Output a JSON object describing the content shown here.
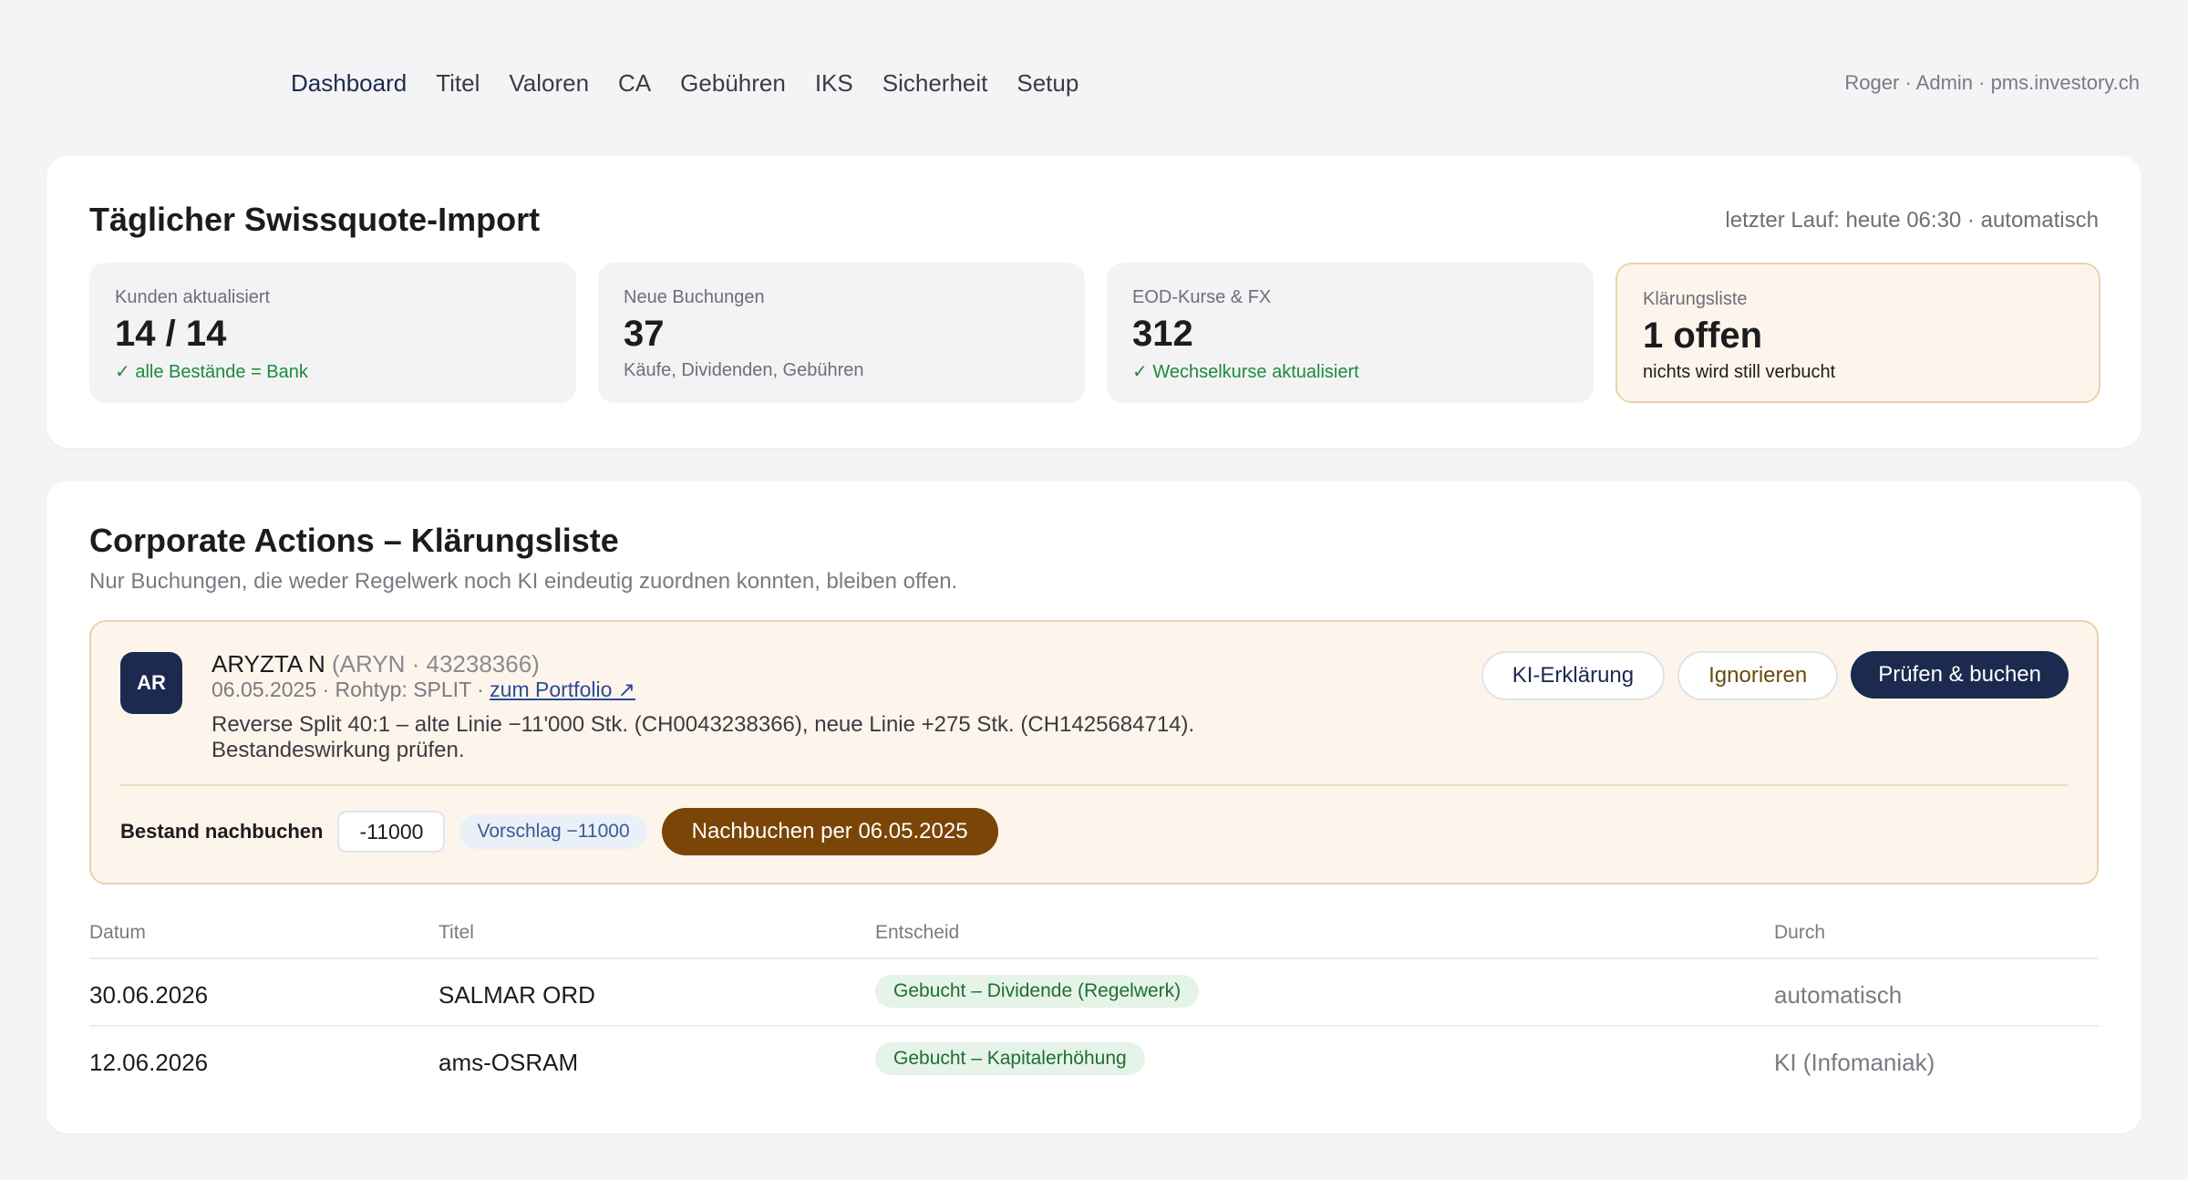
{
  "nav": {
    "items": [
      {
        "label": "Dashboard",
        "active": true
      },
      {
        "label": "Titel"
      },
      {
        "label": "Valoren"
      },
      {
        "label": "CA"
      },
      {
        "label": "Gebühren"
      },
      {
        "label": "IKS"
      },
      {
        "label": "Sicherheit"
      },
      {
        "label": "Setup"
      }
    ],
    "user_info": "Roger · Admin · pms.investory.ch"
  },
  "import": {
    "title": "Täglicher Swissquote-Import",
    "meta": "letzter Lauf: heute 06:30 · automatisch",
    "stats": [
      {
        "label": "Kunden aktualisiert",
        "value": "14 / 14",
        "sub": "✓ alle Bestände = Bank"
      },
      {
        "label": "Neue Buchungen",
        "value": "37",
        "sub": "Käufe, Dividenden, Gebühren"
      },
      {
        "label": "EOD-Kurse & FX",
        "value": "312",
        "sub": "✓ Wechselkurse aktualisiert"
      },
      {
        "label": "Klärungsliste",
        "value": "1 offen",
        "sub": "nichts wird still verbucht"
      }
    ]
  },
  "ca": {
    "title": "Corporate Actions – Klärungsliste",
    "subtitle": "Nur Buchungen, die weder Regelwerk noch KI eindeutig zuordnen konnten, bleiben offen.",
    "pending": {
      "avatar": "AR",
      "name": "ARYZTA N",
      "ids": "(ARYN · 43238366)",
      "meta": "06.05.2025 · Rohtyp: SPLIT · ",
      "portfolio_link": "zum Portfolio ↗",
      "desc_line1": "Reverse Split 40:1 – alte Linie −11'000 Stk. (CH0043238366), neue Linie +275 Stk. (CH1425684714).",
      "desc_line2": "Bestandeswirkung prüfen.",
      "btn_explain": "KI-Erklärung",
      "btn_ignore": "Ignorieren",
      "btn_book": "Prüfen & buchen",
      "bottom_label": "Bestand nachbuchen",
      "input_value": "-11000",
      "suggestion": "Vorschlag −11000",
      "btn_rebook": "Nachbuchen per 06.05.2025"
    },
    "table": {
      "headers": [
        "Datum",
        "Titel",
        "Entscheid",
        "Durch"
      ],
      "rows": [
        {
          "date": "30.06.2026",
          "title": "SALMAR ORD",
          "decision": "Gebucht – Dividende (Regelwerk)",
          "by": "automatisch"
        },
        {
          "date": "12.06.2026",
          "title": "ams-OSRAM",
          "decision": "Gebucht – Kapitalerhöhung",
          "by": "KI (Infomaniak)"
        }
      ]
    }
  }
}
